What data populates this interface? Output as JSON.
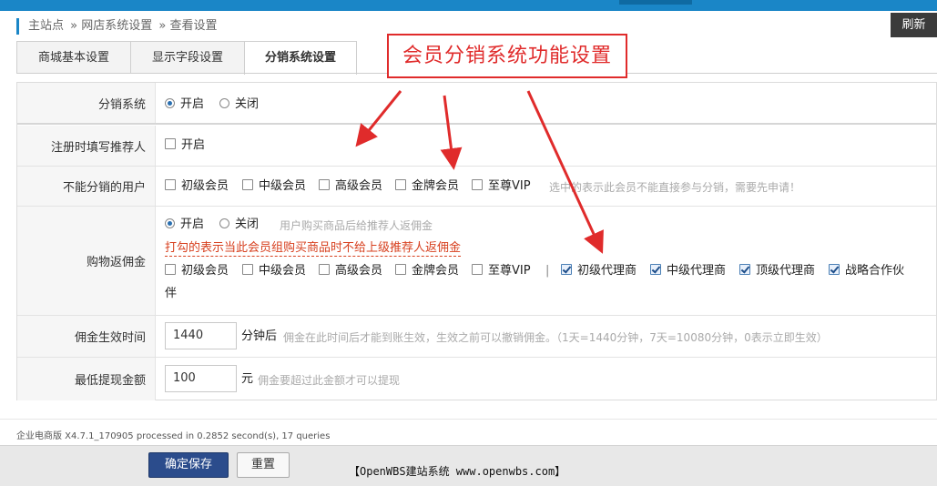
{
  "header": {
    "breadcrumb": [
      "主站点",
      "» 网店系统设置",
      "» 查看设置"
    ],
    "refresh_label": "刷新"
  },
  "tabs": [
    {
      "label": "商城基本设置",
      "active": false
    },
    {
      "label": "显示字段设置",
      "active": false
    },
    {
      "label": "分销系统设置",
      "active": true
    }
  ],
  "callout": "会员分销系统功能设置",
  "form": {
    "distribution_system": {
      "label": "分销系统",
      "options": [
        {
          "label": "开启",
          "selected": true
        },
        {
          "label": "关闭",
          "selected": false
        }
      ]
    },
    "register_referrer": {
      "label": "注册时填写推荐人",
      "option": {
        "label": "开启",
        "checked": false
      }
    },
    "no_distribution_users": {
      "label": "不能分销的用户",
      "options": [
        {
          "label": "初级会员",
          "checked": false
        },
        {
          "label": "中级会员",
          "checked": false
        },
        {
          "label": "高级会员",
          "checked": false
        },
        {
          "label": "金牌会员",
          "checked": false
        },
        {
          "label": "至尊VIP",
          "checked": false
        }
      ],
      "hint": "选中的表示此会员不能直接参与分销，需要先申请！"
    },
    "shopping_rebate": {
      "label": "购物返佣金",
      "options": [
        {
          "label": "开启",
          "selected": true
        },
        {
          "label": "关闭",
          "selected": false
        }
      ],
      "hint": "用户购买商品后给推荐人返佣金",
      "warning": "打勾的表示当此会员组购买商品时不给上级推荐人返佣金",
      "member_groups": [
        {
          "label": "初级会员",
          "checked": false
        },
        {
          "label": "中级会员",
          "checked": false
        },
        {
          "label": "高级会员",
          "checked": false
        },
        {
          "label": "金牌会员",
          "checked": false
        },
        {
          "label": "至尊VIP",
          "checked": false
        }
      ],
      "separator": "|",
      "agent_groups": [
        {
          "label": "初级代理商",
          "checked": true
        },
        {
          "label": "中级代理商",
          "checked": true
        },
        {
          "label": "顶级代理商",
          "checked": true
        },
        {
          "label": "战略合作伙",
          "checked": true
        }
      ],
      "wrap_text": "伴"
    },
    "commission_effective": {
      "label": "佣金生效时间",
      "value": "1440",
      "unit": "分钟后",
      "hint": "佣金在此时间后才能到账生效，生效之前可以撤销佣金。（1天=1440分钟，7天=10080分钟，0表示立即生效）"
    },
    "min_withdraw": {
      "label": "最低提现金额",
      "value": "100",
      "unit": "元",
      "hint": "佣金要超过此金额才可以提现"
    }
  },
  "footer": {
    "info": "企业电商版 X4.7.1_170905 processed in 0.2852 second(s), 17 queries",
    "save_label": "确定保存",
    "reset_label": "重置",
    "site_text": "【OpenWBS建站系统 www.openwbs.com】"
  },
  "colors": {
    "accent": "#1a86c7",
    "callout": "#e02b2b",
    "warning": "#d7401f",
    "save_button": "#2b4c8c"
  }
}
